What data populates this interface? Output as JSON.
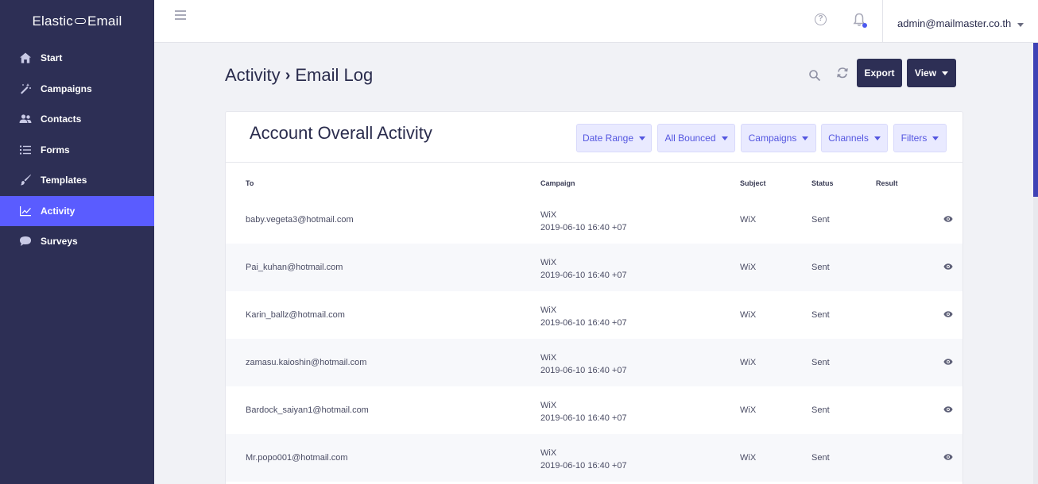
{
  "brand": {
    "left": "Elastic",
    "right": "Email"
  },
  "sidebar": {
    "items": [
      {
        "label": "Start",
        "icon": "home-icon"
      },
      {
        "label": "Campaigns",
        "icon": "magic-wand-icon"
      },
      {
        "label": "Contacts",
        "icon": "users-icon"
      },
      {
        "label": "Forms",
        "icon": "list-icon"
      },
      {
        "label": "Templates",
        "icon": "brush-icon"
      },
      {
        "label": "Activity",
        "icon": "chart-line-icon",
        "active": true
      },
      {
        "label": "Surveys",
        "icon": "chat-bubble-icon"
      }
    ]
  },
  "topbar": {
    "user": "admin@mailmaster.co.th",
    "help_glyph": "?"
  },
  "page": {
    "breadcrumb_parent": "Activity",
    "breadcrumb_sep": "›",
    "breadcrumb_current": "Email Log",
    "export_label": "Export",
    "view_label": "View"
  },
  "card": {
    "title": "Account Overall Activity",
    "filters": [
      "Date Range",
      "All Bounced",
      "Campaigns",
      "Channels",
      "Filters"
    ]
  },
  "table": {
    "columns": [
      "To",
      "Campaign",
      "Subject",
      "Status",
      "Result"
    ],
    "rows": [
      {
        "to": "baby.vegeta3@hotmail.com",
        "campaign": "WiX",
        "date": "2019-06-10 16:40 +07",
        "subject": "WiX",
        "status": "Sent"
      },
      {
        "to": "Pai_kuhan@hotmail.com",
        "campaign": "WiX",
        "date": "2019-06-10 16:40 +07",
        "subject": "WiX",
        "status": "Sent"
      },
      {
        "to": "Karin_ballz@hotmail.com",
        "campaign": "WiX",
        "date": "2019-06-10 16:40 +07",
        "subject": "WiX",
        "status": "Sent"
      },
      {
        "to": "zamasu.kaioshin@hotmail.com",
        "campaign": "WiX",
        "date": "2019-06-10 16:40 +07",
        "subject": "WiX",
        "status": "Sent"
      },
      {
        "to": "Bardock_saiyan1@hotmail.com",
        "campaign": "WiX",
        "date": "2019-06-10 16:40 +07",
        "subject": "WiX",
        "status": "Sent"
      },
      {
        "to": "Mr.popo001@hotmail.com",
        "campaign": "WiX",
        "date": "2019-06-10 16:40 +07",
        "subject": "WiX",
        "status": "Sent"
      }
    ]
  },
  "colors": {
    "sidebar": "#2d2f55",
    "active": "#5a5cff",
    "accent": "#5355e0",
    "filter_bg": "#e9eaff"
  }
}
